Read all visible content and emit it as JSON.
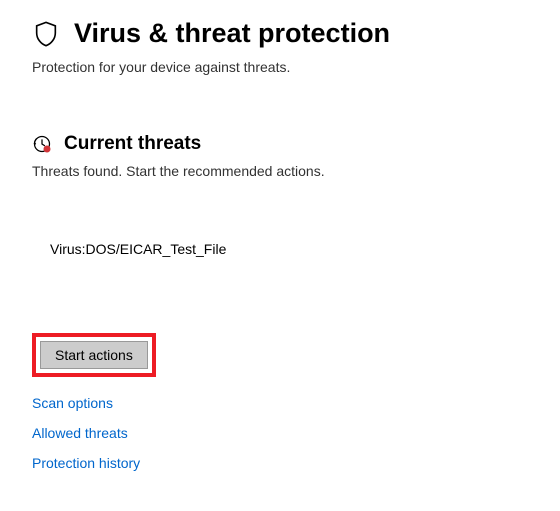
{
  "header": {
    "title": "Virus & threat protection",
    "subtitle": "Protection for your device against threats."
  },
  "current_threats": {
    "title": "Current threats",
    "subtitle": "Threats found. Start the recommended actions.",
    "items": [
      {
        "name": "Virus:DOS/EICAR_Test_File"
      }
    ]
  },
  "actions": {
    "start_button": "Start actions"
  },
  "links": {
    "scan_options": "Scan options",
    "allowed_threats": "Allowed threats",
    "protection_history": "Protection history"
  }
}
